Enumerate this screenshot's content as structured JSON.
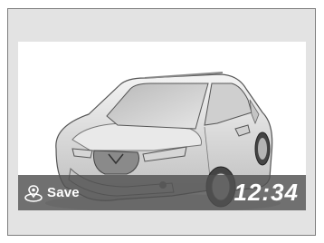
{
  "screen": {
    "image_icon": "car-illustration"
  },
  "bottom_bar": {
    "save_icon": "pin-save-icon",
    "save_label": "Save",
    "clock": "12:34"
  }
}
